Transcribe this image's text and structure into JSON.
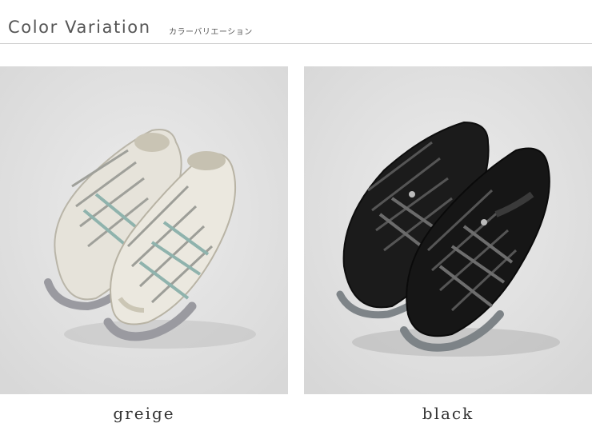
{
  "header": {
    "title": "Color Variation",
    "subtitle": "カラーバリエーション"
  },
  "variants": [
    {
      "label": "greige",
      "color": "#d9d6cb"
    },
    {
      "label": "black",
      "color": "#161616"
    }
  ]
}
